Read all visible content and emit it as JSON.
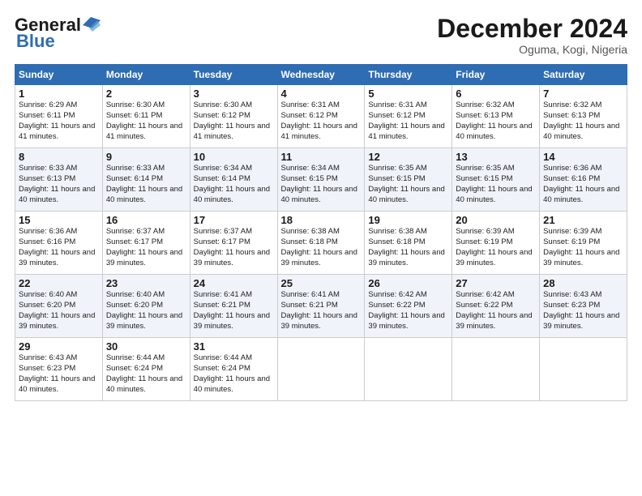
{
  "header": {
    "logo_general": "General",
    "logo_blue": "Blue",
    "month_title": "December 2024",
    "location": "Oguma, Kogi, Nigeria"
  },
  "days_of_week": [
    "Sunday",
    "Monday",
    "Tuesday",
    "Wednesday",
    "Thursday",
    "Friday",
    "Saturday"
  ],
  "weeks": [
    [
      {
        "day": 1,
        "sunrise": "6:29 AM",
        "sunset": "6:11 PM",
        "daylight": "11 hours and 41 minutes"
      },
      {
        "day": 2,
        "sunrise": "6:30 AM",
        "sunset": "6:11 PM",
        "daylight": "11 hours and 41 minutes"
      },
      {
        "day": 3,
        "sunrise": "6:30 AM",
        "sunset": "6:12 PM",
        "daylight": "11 hours and 41 minutes"
      },
      {
        "day": 4,
        "sunrise": "6:31 AM",
        "sunset": "6:12 PM",
        "daylight": "11 hours and 41 minutes"
      },
      {
        "day": 5,
        "sunrise": "6:31 AM",
        "sunset": "6:12 PM",
        "daylight": "11 hours and 41 minutes"
      },
      {
        "day": 6,
        "sunrise": "6:32 AM",
        "sunset": "6:13 PM",
        "daylight": "11 hours and 40 minutes"
      },
      {
        "day": 7,
        "sunrise": "6:32 AM",
        "sunset": "6:13 PM",
        "daylight": "11 hours and 40 minutes"
      }
    ],
    [
      {
        "day": 8,
        "sunrise": "6:33 AM",
        "sunset": "6:13 PM",
        "daylight": "11 hours and 40 minutes"
      },
      {
        "day": 9,
        "sunrise": "6:33 AM",
        "sunset": "6:14 PM",
        "daylight": "11 hours and 40 minutes"
      },
      {
        "day": 10,
        "sunrise": "6:34 AM",
        "sunset": "6:14 PM",
        "daylight": "11 hours and 40 minutes"
      },
      {
        "day": 11,
        "sunrise": "6:34 AM",
        "sunset": "6:15 PM",
        "daylight": "11 hours and 40 minutes"
      },
      {
        "day": 12,
        "sunrise": "6:35 AM",
        "sunset": "6:15 PM",
        "daylight": "11 hours and 40 minutes"
      },
      {
        "day": 13,
        "sunrise": "6:35 AM",
        "sunset": "6:15 PM",
        "daylight": "11 hours and 40 minutes"
      },
      {
        "day": 14,
        "sunrise": "6:36 AM",
        "sunset": "6:16 PM",
        "daylight": "11 hours and 40 minutes"
      }
    ],
    [
      {
        "day": 15,
        "sunrise": "6:36 AM",
        "sunset": "6:16 PM",
        "daylight": "11 hours and 39 minutes"
      },
      {
        "day": 16,
        "sunrise": "6:37 AM",
        "sunset": "6:17 PM",
        "daylight": "11 hours and 39 minutes"
      },
      {
        "day": 17,
        "sunrise": "6:37 AM",
        "sunset": "6:17 PM",
        "daylight": "11 hours and 39 minutes"
      },
      {
        "day": 18,
        "sunrise": "6:38 AM",
        "sunset": "6:18 PM",
        "daylight": "11 hours and 39 minutes"
      },
      {
        "day": 19,
        "sunrise": "6:38 AM",
        "sunset": "6:18 PM",
        "daylight": "11 hours and 39 minutes"
      },
      {
        "day": 20,
        "sunrise": "6:39 AM",
        "sunset": "6:19 PM",
        "daylight": "11 hours and 39 minutes"
      },
      {
        "day": 21,
        "sunrise": "6:39 AM",
        "sunset": "6:19 PM",
        "daylight": "11 hours and 39 minutes"
      }
    ],
    [
      {
        "day": 22,
        "sunrise": "6:40 AM",
        "sunset": "6:20 PM",
        "daylight": "11 hours and 39 minutes"
      },
      {
        "day": 23,
        "sunrise": "6:40 AM",
        "sunset": "6:20 PM",
        "daylight": "11 hours and 39 minutes"
      },
      {
        "day": 24,
        "sunrise": "6:41 AM",
        "sunset": "6:21 PM",
        "daylight": "11 hours and 39 minutes"
      },
      {
        "day": 25,
        "sunrise": "6:41 AM",
        "sunset": "6:21 PM",
        "daylight": "11 hours and 39 minutes"
      },
      {
        "day": 26,
        "sunrise": "6:42 AM",
        "sunset": "6:22 PM",
        "daylight": "11 hours and 39 minutes"
      },
      {
        "day": 27,
        "sunrise": "6:42 AM",
        "sunset": "6:22 PM",
        "daylight": "11 hours and 39 minutes"
      },
      {
        "day": 28,
        "sunrise": "6:43 AM",
        "sunset": "6:23 PM",
        "daylight": "11 hours and 39 minutes"
      }
    ],
    [
      {
        "day": 29,
        "sunrise": "6:43 AM",
        "sunset": "6:23 PM",
        "daylight": "11 hours and 40 minutes"
      },
      {
        "day": 30,
        "sunrise": "6:44 AM",
        "sunset": "6:24 PM",
        "daylight": "11 hours and 40 minutes"
      },
      {
        "day": 31,
        "sunrise": "6:44 AM",
        "sunset": "6:24 PM",
        "daylight": "11 hours and 40 minutes"
      },
      null,
      null,
      null,
      null
    ]
  ]
}
